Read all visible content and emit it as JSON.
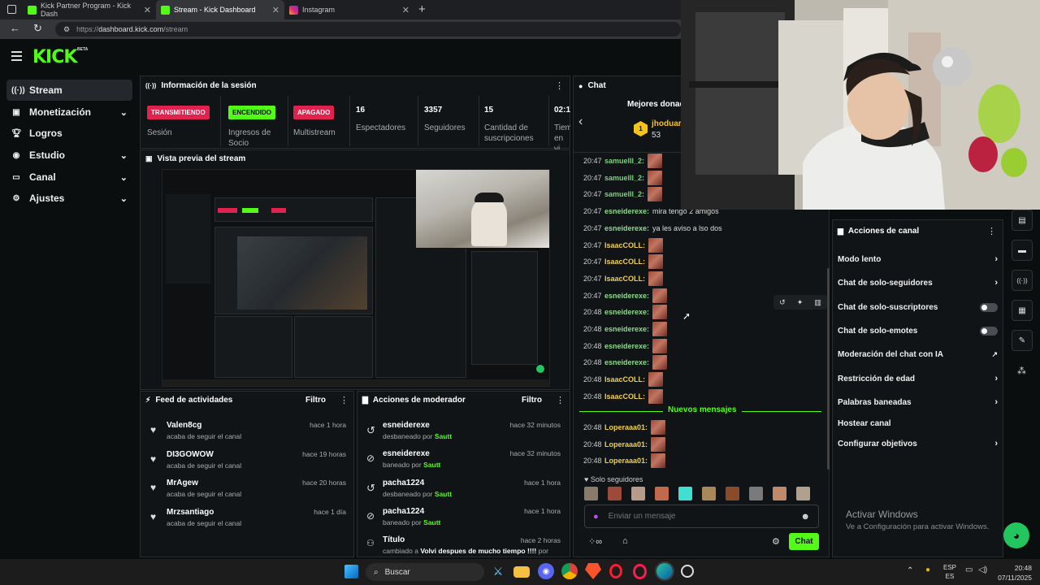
{
  "browser": {
    "tabs": [
      {
        "title": "Kick Partner Program - Kick Dash"
      },
      {
        "title": "Stream - Kick Dashboard"
      },
      {
        "title": "Instagram"
      }
    ],
    "url_prefix": "https://",
    "url_host": "dashboard.kick.com",
    "url_path": "/stream"
  },
  "brand": {
    "logo": "KICK",
    "beta": "BETA",
    "accent": "#53fc18"
  },
  "sidebar": {
    "items": [
      {
        "label": "Stream",
        "icon": "broadcast-icon"
      },
      {
        "label": "Monetización",
        "icon": "money-icon"
      },
      {
        "label": "Logros",
        "icon": "trophy-icon"
      },
      {
        "label": "Estudio",
        "icon": "studio-icon"
      },
      {
        "label": "Canal",
        "icon": "channel-icon"
      },
      {
        "label": "Ajustes",
        "icon": "gear-icon"
      }
    ]
  },
  "session": {
    "title": "Información de la sesión",
    "items": [
      {
        "badge": "TRANSMITIENDO",
        "label": "Sesión"
      },
      {
        "badge": "ENCENDIDO",
        "label": "Ingresos de Socio"
      },
      {
        "badge": "APAGADO",
        "label": "Multistream"
      },
      {
        "value": "16",
        "label": "Espectadores"
      },
      {
        "value": "3357",
        "label": "Seguidores"
      },
      {
        "value": "15",
        "label": "Cantidad de suscripciones"
      },
      {
        "value": "02:1",
        "label": "Tiem en vi"
      }
    ]
  },
  "preview": {
    "title": "Vista previa del stream"
  },
  "activity": {
    "title": "Feed de actividades",
    "filter": "Filtro",
    "items": [
      {
        "name": "Valen8cg",
        "action": "acaba de seguir el canal",
        "time": "hace 1 hora"
      },
      {
        "name": "DI3GOWOW",
        "action": "acaba de seguir el canal",
        "time": "hace 19 horas"
      },
      {
        "name": "MrAgew",
        "action": "acaba de seguir el canal",
        "time": "hace 20 horas"
      },
      {
        "name": "Mrzsantiago",
        "action": "acaba de seguir el canal",
        "time": "hace 1 día"
      }
    ]
  },
  "modactions": {
    "title": "Acciones de moderador",
    "filter": "Filtro",
    "by": "Sautt",
    "items": [
      {
        "name": "esneiderexe",
        "action": "desbaneado por",
        "time": "hace 32 minutos",
        "icon": "undo-icon"
      },
      {
        "name": "esneiderexe",
        "action": "baneado por",
        "time": "hace 32 minutos",
        "icon": "ban-icon"
      },
      {
        "name": "pacha1224",
        "action": "desbaneado por",
        "time": "hace 1 hora",
        "icon": "undo-icon"
      },
      {
        "name": "pacha1224",
        "action": "baneado por",
        "time": "hace 1 hora",
        "icon": "ban-icon"
      },
      {
        "name": "Título",
        "action": "cambiado a",
        "extra": "Volvi despues de mucho tiempo !!!!",
        "extra2": "por",
        "time": "hace 2 horas",
        "icon": "title-icon"
      }
    ]
  },
  "chat": {
    "title": "Chat",
    "top_donors": "Mejores donad",
    "donor_name": "jhoduar",
    "donor_amount": "53",
    "messages": [
      {
        "time": "20:47",
        "user": "samuelll_2:",
        "color": "#7bd37b",
        "text": ""
      },
      {
        "time": "20:47",
        "user": "samuelll_2:",
        "color": "#7bd37b",
        "text": ""
      },
      {
        "time": "20:47",
        "user": "samuelll_2:",
        "color": "#7bd37b",
        "text": ""
      },
      {
        "time": "20:47",
        "user": "esneiderexe:",
        "color": "#8fd88f",
        "text": "mira tengo 2 amigos"
      },
      {
        "time": "20:47",
        "user": "esneiderexe:",
        "color": "#8fd88f",
        "text": "ya les aviso a lso dos"
      },
      {
        "time": "20:47",
        "user": "IsaacCOLL:",
        "color": "#f0d04a",
        "text": ""
      },
      {
        "time": "20:47",
        "user": "IsaacCOLL:",
        "color": "#f0d04a",
        "text": ""
      },
      {
        "time": "20:47",
        "user": "IsaacCOLL:",
        "color": "#f0d04a",
        "text": ""
      },
      {
        "time": "20:47",
        "user": "esneiderexe:",
        "color": "#8fd88f",
        "text": ""
      },
      {
        "time": "20:48",
        "user": "esneiderexe:",
        "color": "#8fd88f",
        "text": ""
      },
      {
        "time": "20:48",
        "user": "esneiderexe:",
        "color": "#8fd88f",
        "text": ""
      },
      {
        "time": "20:48",
        "user": "esneiderexe:",
        "color": "#8fd88f",
        "text": ""
      },
      {
        "time": "20:48",
        "user": "esneiderexe:",
        "color": "#8fd88f",
        "text": ""
      },
      {
        "time": "20:48",
        "user": "IsaacCOLL:",
        "color": "#f0d04a",
        "text": ""
      },
      {
        "time": "20:48",
        "user": "IsaacCOLL:",
        "color": "#f0d04a",
        "text": ""
      }
    ],
    "new_messages": "Nuevos mensajes",
    "new_list": [
      {
        "time": "20:48",
        "user": "Loperaaa01:",
        "color": "#f0d04a"
      },
      {
        "time": "20:48",
        "user": "Loperaaa01:",
        "color": "#f0d04a"
      },
      {
        "time": "20:48",
        "user": "Loperaaa01:",
        "color": "#f0d04a"
      }
    ],
    "followers_only": "Solo seguidores",
    "input_placeholder": "Enviar un mensaje",
    "send_label": "Chat"
  },
  "channel_actions": {
    "title": "Acciones de canal",
    "items": [
      {
        "label": "Modo lento",
        "type": "arrow"
      },
      {
        "label": "Chat de solo-seguidores",
        "type": "arrow"
      },
      {
        "label": "Chat de solo-suscriptores",
        "type": "toggle",
        "on": false
      },
      {
        "label": "Chat de solo-emotes",
        "type": "toggle",
        "on": false
      },
      {
        "label": "Moderación del chat con IA",
        "type": "external"
      },
      {
        "label": "Restricción de edad",
        "type": "arrow"
      },
      {
        "label": "Palabras baneadas",
        "type": "arrow"
      },
      {
        "label": "Hostear canal",
        "type": "none"
      },
      {
        "label": "Configurar objetivos",
        "type": "arrow"
      }
    ]
  },
  "watermark": {
    "line1": "Activar Windows",
    "line2": "Ve a Configuración para activar Windows."
  },
  "taskbar": {
    "search": "Buscar",
    "lang1": "ESP",
    "lang2": "ES",
    "time": "20:48",
    "date": "07/11/2025"
  }
}
